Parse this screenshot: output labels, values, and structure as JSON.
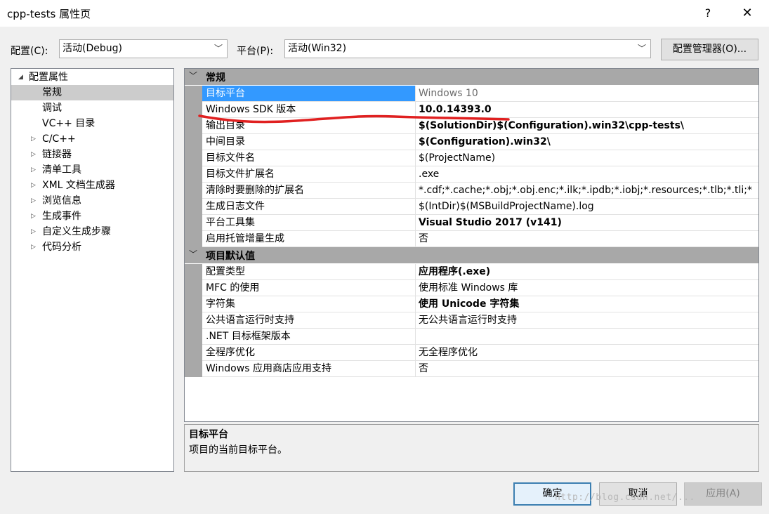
{
  "window": {
    "title": "cpp-tests 属性页",
    "help_label": "?",
    "close_label": "✕"
  },
  "config_bar": {
    "config_label": "配置(C):",
    "config_value": "活动(Debug)",
    "platform_label": "平台(P):",
    "platform_value": "活动(Win32)",
    "manager_button": "配置管理器(O)..."
  },
  "tree": [
    {
      "label": "配置属性",
      "expander": "◢",
      "level": 0
    },
    {
      "label": "常规",
      "expander": "",
      "level": 1,
      "selected": true
    },
    {
      "label": "调试",
      "expander": "",
      "level": 1
    },
    {
      "label": "VC++ 目录",
      "expander": "",
      "level": 1
    },
    {
      "label": "C/C++",
      "expander": "▷",
      "level": 1
    },
    {
      "label": "链接器",
      "expander": "▷",
      "level": 1
    },
    {
      "label": "清单工具",
      "expander": "▷",
      "level": 1
    },
    {
      "label": "XML 文档生成器",
      "expander": "▷",
      "level": 1
    },
    {
      "label": "浏览信息",
      "expander": "▷",
      "level": 1
    },
    {
      "label": "生成事件",
      "expander": "▷",
      "level": 1
    },
    {
      "label": "自定义生成步骤",
      "expander": "▷",
      "level": 1
    },
    {
      "label": "代码分析",
      "expander": "▷",
      "level": 1
    }
  ],
  "grid": {
    "sections": [
      {
        "title": "常规",
        "rows": [
          {
            "name": "目标平台",
            "value": "Windows 10",
            "bold": false,
            "selected": true
          },
          {
            "name": "Windows SDK 版本",
            "value": "10.0.14393.0",
            "bold": true
          },
          {
            "name": "输出目录",
            "value": "$(SolutionDir)$(Configuration).win32\\cpp-tests\\",
            "bold": true
          },
          {
            "name": "中间目录",
            "value": "$(Configuration).win32\\",
            "bold": true
          },
          {
            "name": "目标文件名",
            "value": "$(ProjectName)",
            "bold": false
          },
          {
            "name": "目标文件扩展名",
            "value": ".exe",
            "bold": false
          },
          {
            "name": "清除时要删除的扩展名",
            "value": "*.cdf;*.cache;*.obj;*.obj.enc;*.ilk;*.ipdb;*.iobj;*.resources;*.tlb;*.tli;*",
            "bold": false
          },
          {
            "name": "生成日志文件",
            "value": "$(IntDir)$(MSBuildProjectName).log",
            "bold": false
          },
          {
            "name": "平台工具集",
            "value": "Visual Studio 2017 (v141)",
            "bold": true
          },
          {
            "name": "启用托管增量生成",
            "value": "否",
            "bold": false
          }
        ]
      },
      {
        "title": "项目默认值",
        "rows": [
          {
            "name": "配置类型",
            "value": "应用程序(.exe)",
            "bold": true
          },
          {
            "name": "MFC 的使用",
            "value": "使用标准 Windows 库",
            "bold": false
          },
          {
            "name": "字符集",
            "value": "使用 Unicode 字符集",
            "bold": true
          },
          {
            "name": "公共语言运行时支持",
            "value": "无公共语言运行时支持",
            "bold": false
          },
          {
            "name": ".NET 目标框架版本",
            "value": "",
            "bold": false
          },
          {
            "name": "全程序优化",
            "value": "无全程序优化",
            "bold": false
          },
          {
            "name": "Windows 应用商店应用支持",
            "value": "否",
            "bold": false
          }
        ]
      }
    ]
  },
  "description": {
    "title": "目标平台",
    "text": "项目的当前目标平台。"
  },
  "buttons": {
    "ok": "确定",
    "cancel": "取消",
    "apply": "应用(A)"
  },
  "watermark": "http://blog.csdn.net/..."
}
